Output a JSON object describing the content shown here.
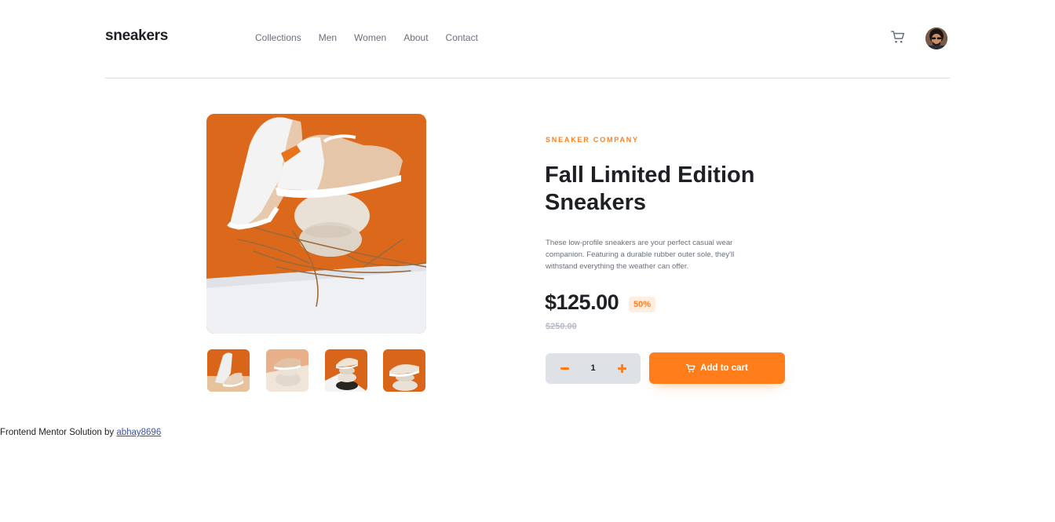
{
  "header": {
    "logo": "sneakers",
    "nav": [
      "Collections",
      "Men",
      "Women",
      "About",
      "Contact"
    ]
  },
  "product": {
    "company": "SNEAKER COMPANY",
    "title": "Fall Limited Edition Sneakers",
    "description": "These low-profile sneakers are your perfect casual wear companion. Featuring a durable rubber outer sole, they'll withstand everything the weather can offer.",
    "price": "$125.00",
    "discount": "50%",
    "old_price": "$250.00",
    "quantity": "1",
    "add_to_cart": "Add to cart"
  },
  "gallery": {
    "thumbnail_count": 4
  },
  "attribution": {
    "text": "Frontend Mentor Solution by",
    "author": "abhay8696"
  },
  "colors": {
    "accent": "#ff7e1b",
    "accent_pale": "#ffede0",
    "text_dark": "#1d2025",
    "text_muted": "#69707d"
  },
  "icons": {
    "cart": "cart-icon",
    "minus": "minus-icon",
    "plus": "plus-icon"
  }
}
